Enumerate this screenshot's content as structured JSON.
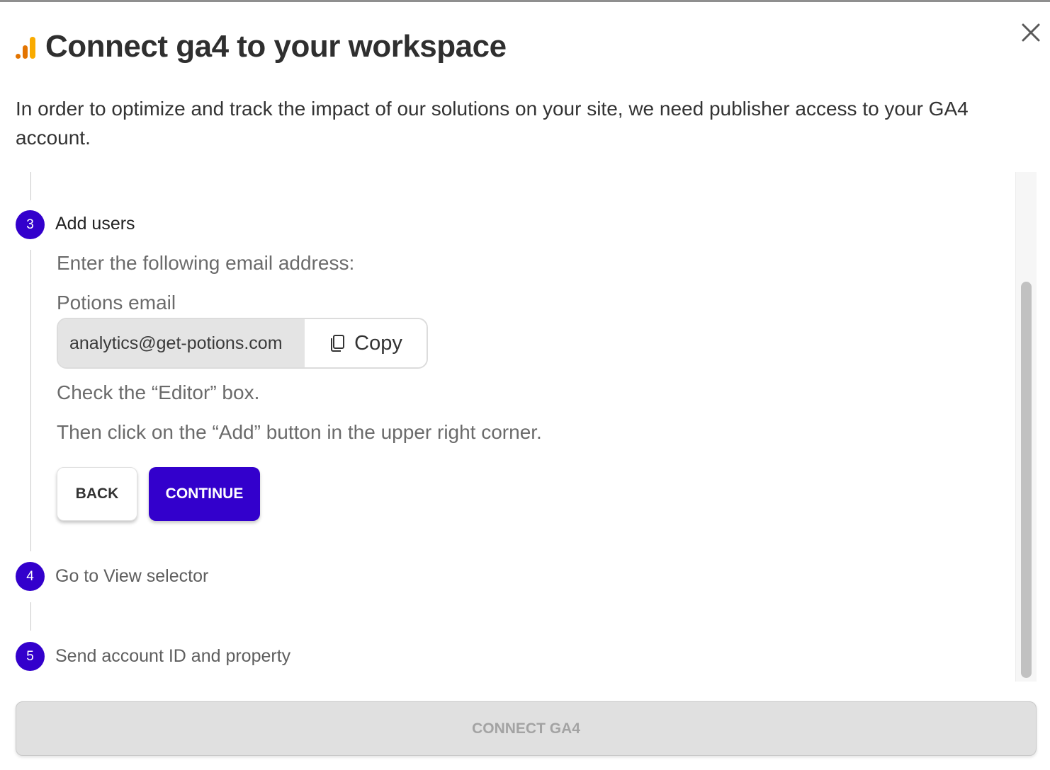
{
  "dialog": {
    "title": "Connect ga4 to your workspace",
    "intro": "In order to optimize and track the impact of our solutions on your site, we need publisher access to your GA4 account.",
    "icons": {
      "logo": "google-analytics-icon",
      "close": "close-icon",
      "copy": "copy-icon"
    },
    "accent_color": "#3300cc"
  },
  "steps": [
    {
      "number": "3",
      "label": "Add users",
      "state": "active"
    },
    {
      "number": "4",
      "label": "Go to View selector",
      "state": "inactive"
    },
    {
      "number": "5",
      "label": "Send account ID and property",
      "state": "inactive"
    }
  ],
  "active_step": {
    "instruction": "Enter the following email address:",
    "email_label": "Potions email",
    "email_value": "analytics@get-potions.com",
    "copy_label": "Copy",
    "check_text": "Check the “Editor” box.",
    "add_text": "Then click on the “Add” button in the upper right corner.",
    "back_label": "BACK",
    "continue_label": "CONTINUE"
  },
  "footer": {
    "connect_label": "CONNECT GA4",
    "connect_disabled": true
  }
}
